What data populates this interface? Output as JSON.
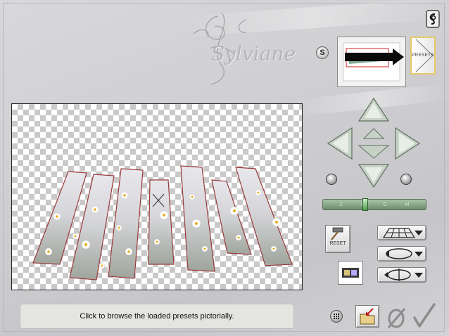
{
  "logo": {
    "text": "Sylviane"
  },
  "status": {
    "text": "Click to browse the loaded presets pictorially."
  },
  "presets": {
    "label": "PRESETS"
  },
  "side_button": {
    "label": "S"
  },
  "reset": {
    "label": "RESET"
  },
  "zoom": {
    "label": "ZOOM"
  },
  "colors": {
    "accent_green": "#6c8e6c",
    "presets_border": "#e8c868",
    "strip_border": "#9a3a3a"
  },
  "icons": {
    "top_right": "curl-icon",
    "nav": [
      "arrow-up-icon",
      "arrow-left-icon",
      "arrow-right-icon",
      "arrow-down-icon",
      "center-up-icon",
      "center-down-icon"
    ],
    "modes": [
      "perspective-plane-icon",
      "rotate-ellipse-icon",
      "rotate-axis-icon"
    ],
    "bottom": [
      "grid-icon",
      "export-icon",
      "cancel-icon",
      "ok-check-icon"
    ]
  }
}
